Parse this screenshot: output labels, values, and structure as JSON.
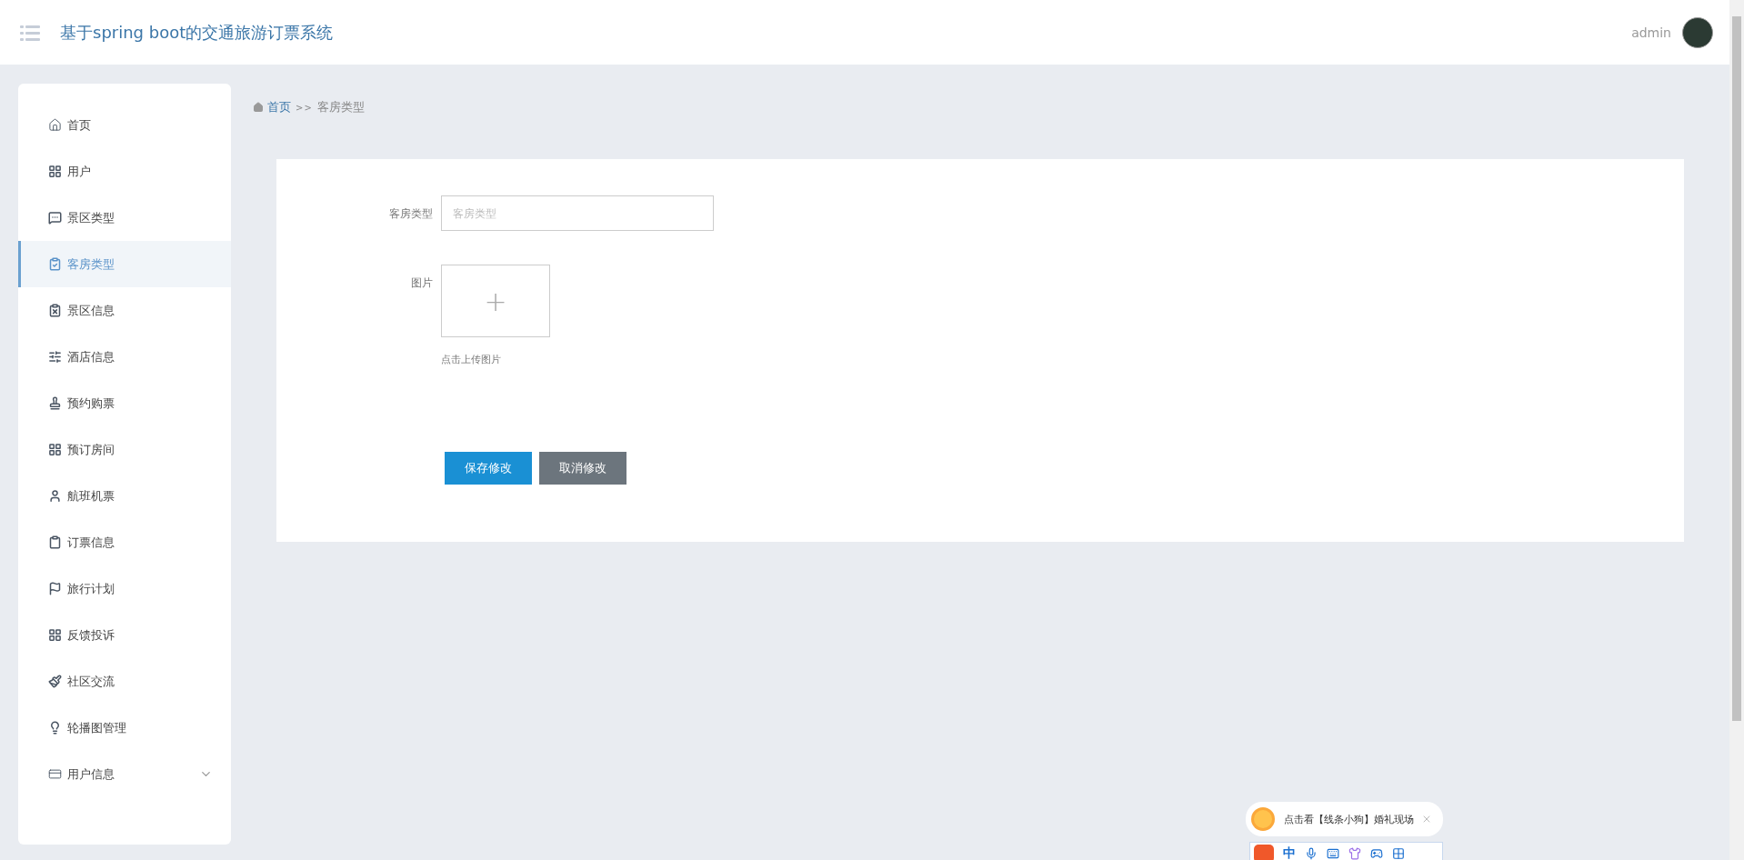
{
  "header": {
    "title": "基于spring boot的交通旅游订票系统",
    "user": "admin"
  },
  "sidebar": {
    "items": [
      {
        "label": "首页",
        "selected": false,
        "kind": "link"
      },
      {
        "label": "用户",
        "selected": false,
        "kind": "link"
      },
      {
        "label": "景区类型",
        "selected": false,
        "kind": "link"
      },
      {
        "label": "客房类型",
        "selected": true,
        "kind": "link"
      },
      {
        "label": "景区信息",
        "selected": false,
        "kind": "link"
      },
      {
        "label": "酒店信息",
        "selected": false,
        "kind": "link"
      },
      {
        "label": "预约购票",
        "selected": false,
        "kind": "link"
      },
      {
        "label": "预订房间",
        "selected": false,
        "kind": "link"
      },
      {
        "label": "航班机票",
        "selected": false,
        "kind": "link"
      },
      {
        "label": "订票信息",
        "selected": false,
        "kind": "link"
      },
      {
        "label": "旅行计划",
        "selected": false,
        "kind": "link"
      },
      {
        "label": "反馈投诉",
        "selected": false,
        "kind": "link"
      },
      {
        "label": "社区交流",
        "selected": false,
        "kind": "link"
      },
      {
        "label": "轮播图管理",
        "selected": false,
        "kind": "link"
      },
      {
        "label": "用户信息",
        "selected": false,
        "kind": "group"
      }
    ]
  },
  "breadcrumb": {
    "home": "首页",
    "separator": ">>",
    "current": "客房类型"
  },
  "form": {
    "fields": [
      {
        "label": "客房类型",
        "placeholder": "客房类型"
      }
    ],
    "upload": {
      "label": "图片",
      "symbol": "+",
      "hint": "点击上传图片"
    },
    "buttons": [
      {
        "label": "保存修改",
        "kind": "primary"
      },
      {
        "label": "取消修改",
        "kind": "secondary"
      }
    ]
  },
  "ime": {
    "tip": "点击看【线条小狗】婚礼现场",
    "mode": "中"
  }
}
